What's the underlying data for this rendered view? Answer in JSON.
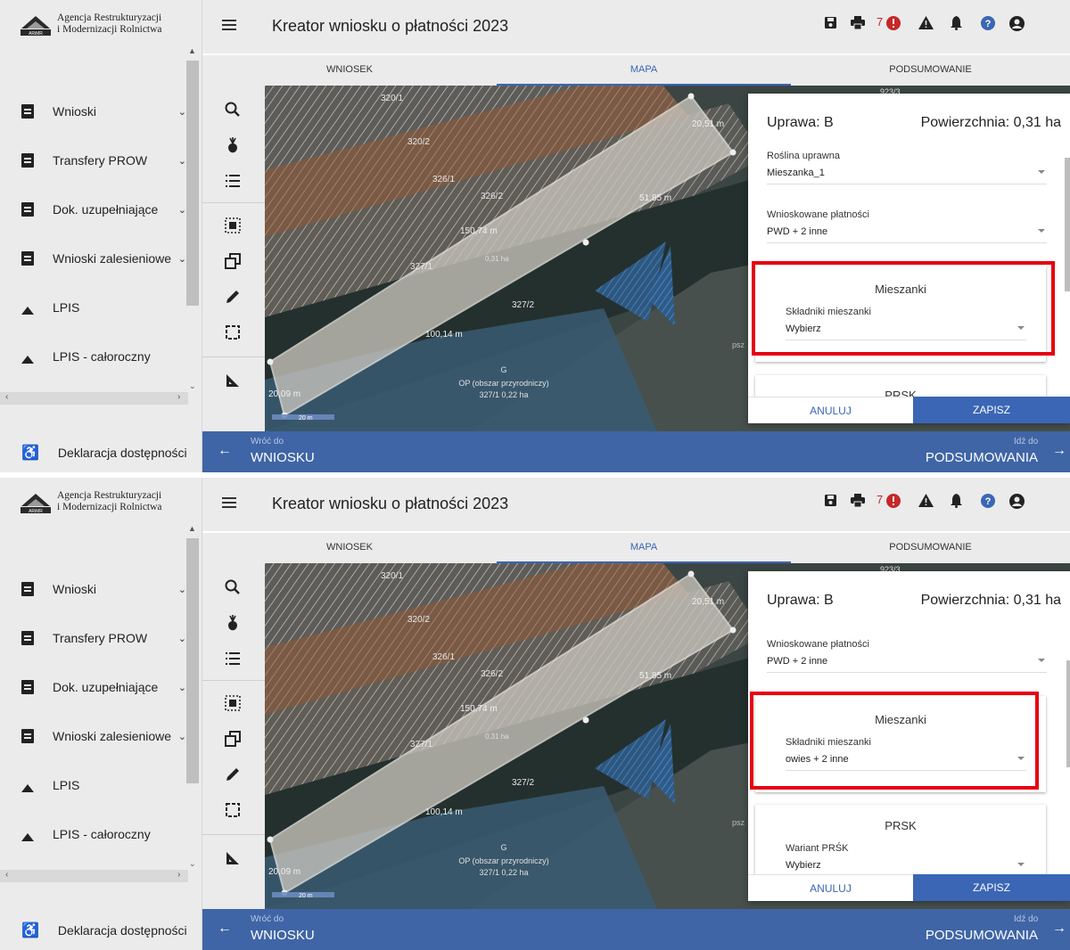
{
  "logo": {
    "line1": "Agencja Restrukturyzacji",
    "line2": "i Modernizacji Rolnictwa",
    "mark_text": "ARiMR"
  },
  "sidebar": {
    "items": [
      {
        "label": "Wnioski",
        "icon": "clipboard-icon"
      },
      {
        "label": "Transfery PROW",
        "icon": "clipboard-icon"
      },
      {
        "label": "Dok. uzupełniające",
        "icon": "clipboard-icon"
      },
      {
        "label": "Wnioski zalesieniowe",
        "icon": "clipboard-icon"
      },
      {
        "label": "LPIS",
        "icon": "mountain-icon"
      },
      {
        "label": "LPIS - całoroczny",
        "icon": "mountain-icon"
      }
    ],
    "footer": "Deklaracja dostępności"
  },
  "header": {
    "title": "Kreator wniosku o płatności 2023",
    "error_count": "7"
  },
  "tabs": [
    {
      "label": "WNIOSEK",
      "active": false
    },
    {
      "label": "MAPA",
      "active": true
    },
    {
      "label": "PODSUMOWANIE",
      "active": false
    }
  ],
  "map": {
    "parcels": [
      "320/1",
      "320/2",
      "326/1",
      "326/2",
      "327/1",
      "327/2",
      "923/3"
    ],
    "measures": [
      "20,51 m",
      "51,85 m",
      "150,74 m",
      "100,14 m",
      "20,09 m"
    ],
    "area_label": "0,31 ha",
    "g_label": "G",
    "op_label": "OP (obszar przyrodniczy)",
    "op_area": "327/1 0,22 ha",
    "scale": "20 m",
    "side_text": "psz"
  },
  "panel1": {
    "dialog": {
      "crop": "Uprawa: B",
      "area": "Powierzchnia: 0,31 ha",
      "plant_label": "Roślina uprawna",
      "plant_value": "Mieszanka_1",
      "payments_label": "Wnioskowane płatności",
      "payments_value": "PWD + 2 inne",
      "mix_title": "Mieszanki",
      "mix_label": "Składniki mieszanki",
      "mix_value": "Wybierz",
      "prsk_title": "PRSK",
      "cancel": "ANULUJ",
      "save": "ZAPISZ"
    }
  },
  "panel2": {
    "dialog": {
      "crop": "Uprawa: B",
      "area": "Powierzchnia: 0,31 ha",
      "payments_label": "Wnioskowane płatności",
      "payments_value": "PWD + 2 inne",
      "mix_title": "Mieszanki",
      "mix_label": "Składniki mieszanki",
      "mix_value": "owies + 2 inne",
      "prsk_title": "PRSK",
      "prsk_label": "Wariant PRŚK",
      "prsk_value": "Wybierz",
      "cancel": "ANULUJ",
      "save": "ZAPISZ"
    }
  },
  "bottom": {
    "back_small": "Wróć do",
    "back_big": "WNIOSKU",
    "next_small": "Idź do",
    "next_big": "PODSUMOWANIA"
  },
  "colors": {
    "accent": "#3a66b5",
    "highlight": "#e60012",
    "nav_bar": "#3f65a6"
  }
}
